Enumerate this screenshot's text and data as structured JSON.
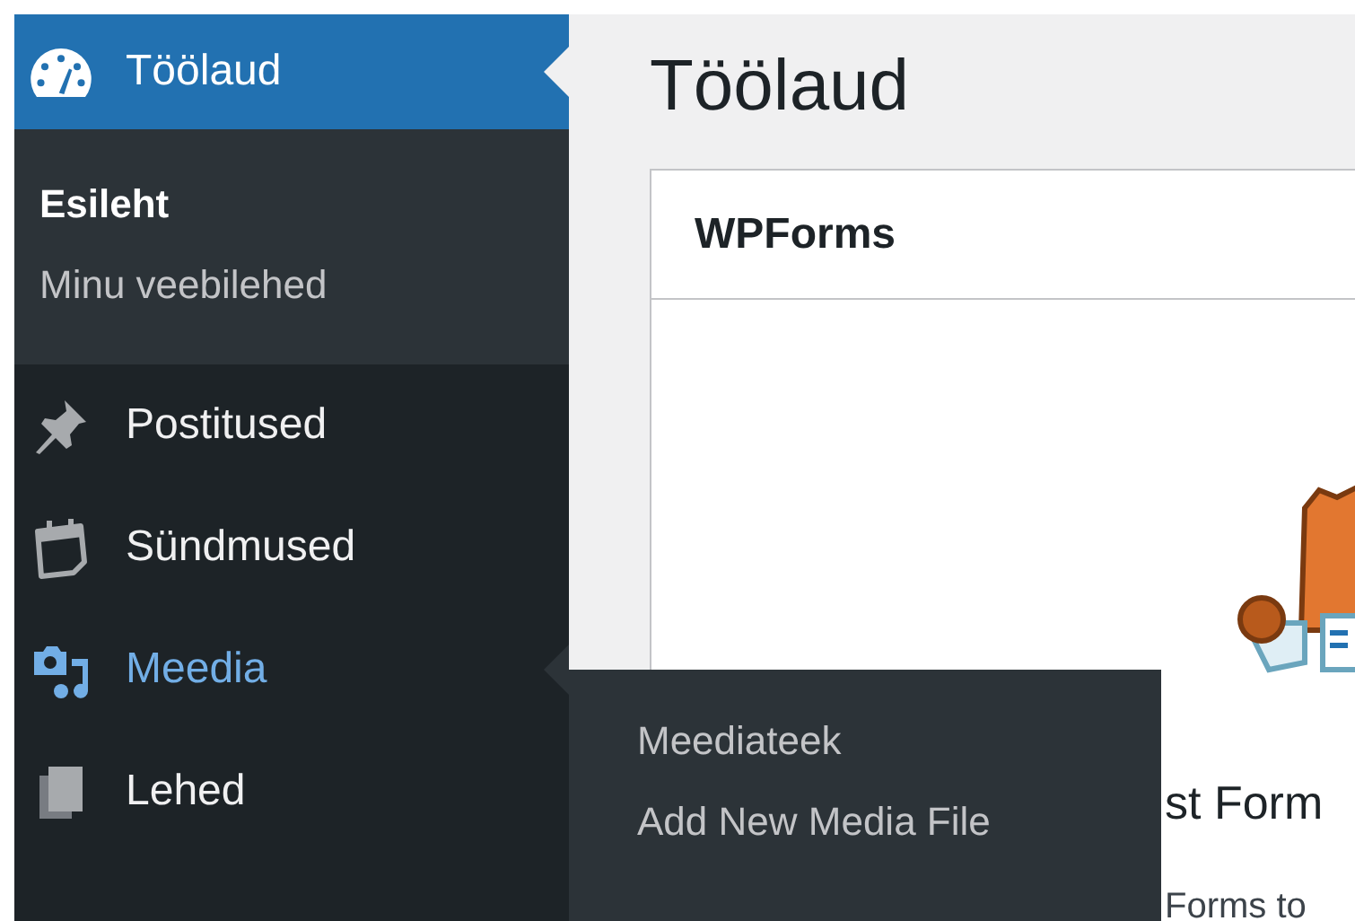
{
  "menu": [
    {
      "label": "Töölaud",
      "selected": true,
      "flyout_open": false,
      "submenu": [
        {
          "label": "Esileht",
          "selected": true
        },
        {
          "label": "Minu veebilehed",
          "selected": false
        }
      ]
    },
    {
      "label": "Postitused",
      "selected": false,
      "flyout_open": false
    },
    {
      "label": "Sündmused",
      "selected": false,
      "flyout_open": false
    },
    {
      "label": "Meedia",
      "selected": false,
      "flyout_open": true,
      "flyout": [
        {
          "label": "Meediateek"
        },
        {
          "label": "Add New Media File"
        }
      ]
    },
    {
      "label": "Lehed",
      "selected": false,
      "flyout_open": false
    }
  ],
  "page_title": "Töölaud",
  "widget": {
    "title": "WPForms",
    "heading_fragment": "st Form",
    "text_fragment": "Forms to"
  }
}
